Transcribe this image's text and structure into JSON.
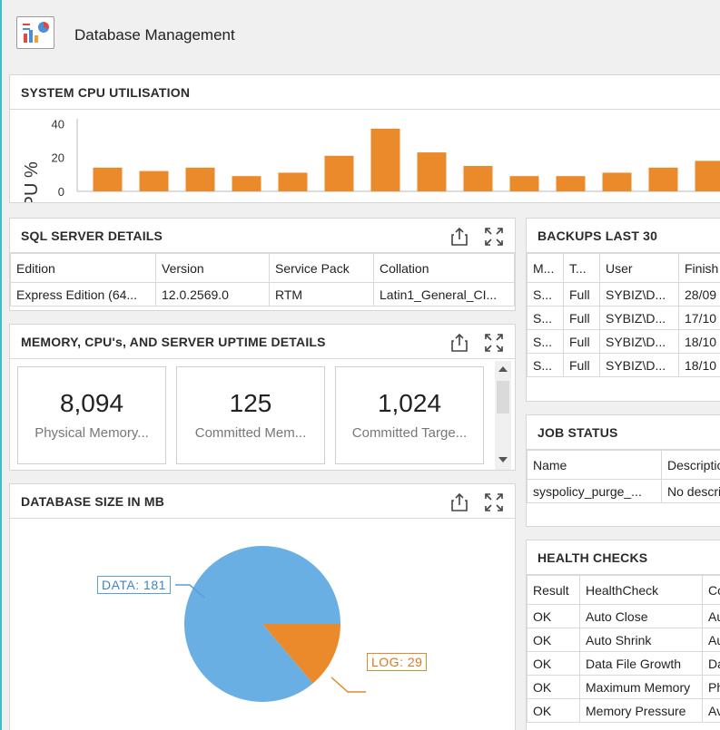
{
  "app": {
    "title": "Database Management"
  },
  "cpu_panel": {
    "title": "SYSTEM CPU UTILISATION"
  },
  "chart_data": {
    "type": "bar",
    "title": "SYSTEM CPU UTILISATION",
    "ylabel": "CPU %",
    "ylim": [
      0,
      45
    ],
    "yticks": [
      "0",
      "20",
      "40"
    ],
    "values": [
      14,
      12,
      14,
      9,
      11,
      21,
      37,
      23,
      15,
      9,
      9,
      11,
      14,
      18
    ],
    "color": "#eb8a2a",
    "grid": false
  },
  "sql_details": {
    "title": "SQL SERVER DETAILS",
    "columns": [
      "Edition",
      "Version",
      "Service Pack",
      "Collation"
    ],
    "rows": [
      [
        "Express Edition (64...",
        "12.0.2569.0",
        "RTM",
        "Latin1_General_CI..."
      ]
    ]
  },
  "memory_panel": {
    "title": "MEMORY, CPU's, AND SERVER UPTIME DETAILS",
    "cards": [
      {
        "value": "8,094",
        "label": "Physical Memory..."
      },
      {
        "value": "125",
        "label": "Committed Mem..."
      },
      {
        "value": "1,024",
        "label": "Committed Targe..."
      }
    ]
  },
  "db_size": {
    "title": "DATABASE SIZE IN MB",
    "slices": [
      {
        "label": "DATA: 181",
        "value": 181,
        "color": "#6aafe3"
      },
      {
        "label": "LOG: 29",
        "value": 29,
        "color": "#eb8a2a"
      }
    ]
  },
  "backups": {
    "title": "BACKUPS LAST 30",
    "columns": [
      "M...",
      "T...",
      "User",
      "Finish"
    ],
    "rows": [
      [
        "S...",
        "Full",
        "SYBIZ\\D...",
        "28/09"
      ],
      [
        "S...",
        "Full",
        "SYBIZ\\D...",
        "17/10"
      ],
      [
        "S...",
        "Full",
        "SYBIZ\\D...",
        "18/10"
      ],
      [
        "S...",
        "Full",
        "SYBIZ\\D...",
        "18/10"
      ]
    ]
  },
  "job_status": {
    "title": "JOB STATUS",
    "columns": [
      "Name",
      "Descriptio"
    ],
    "rows": [
      [
        "syspolicy_purge_...",
        "No descri"
      ]
    ]
  },
  "health_checks": {
    "title": "HEALTH CHECKS",
    "columns": [
      "Result",
      "HealthCheck",
      "Co"
    ],
    "rows": [
      [
        "OK",
        "Auto Close",
        "Au"
      ],
      [
        "OK",
        "Auto Shrink",
        "Au"
      ],
      [
        "OK",
        "Data File Growth",
        "Da"
      ],
      [
        "OK",
        "Maximum Memory",
        "Ph"
      ],
      [
        "OK",
        "Memory Pressure",
        "Av"
      ]
    ]
  },
  "icons": {
    "export": "export-icon",
    "maximize": "maximize-icon"
  }
}
